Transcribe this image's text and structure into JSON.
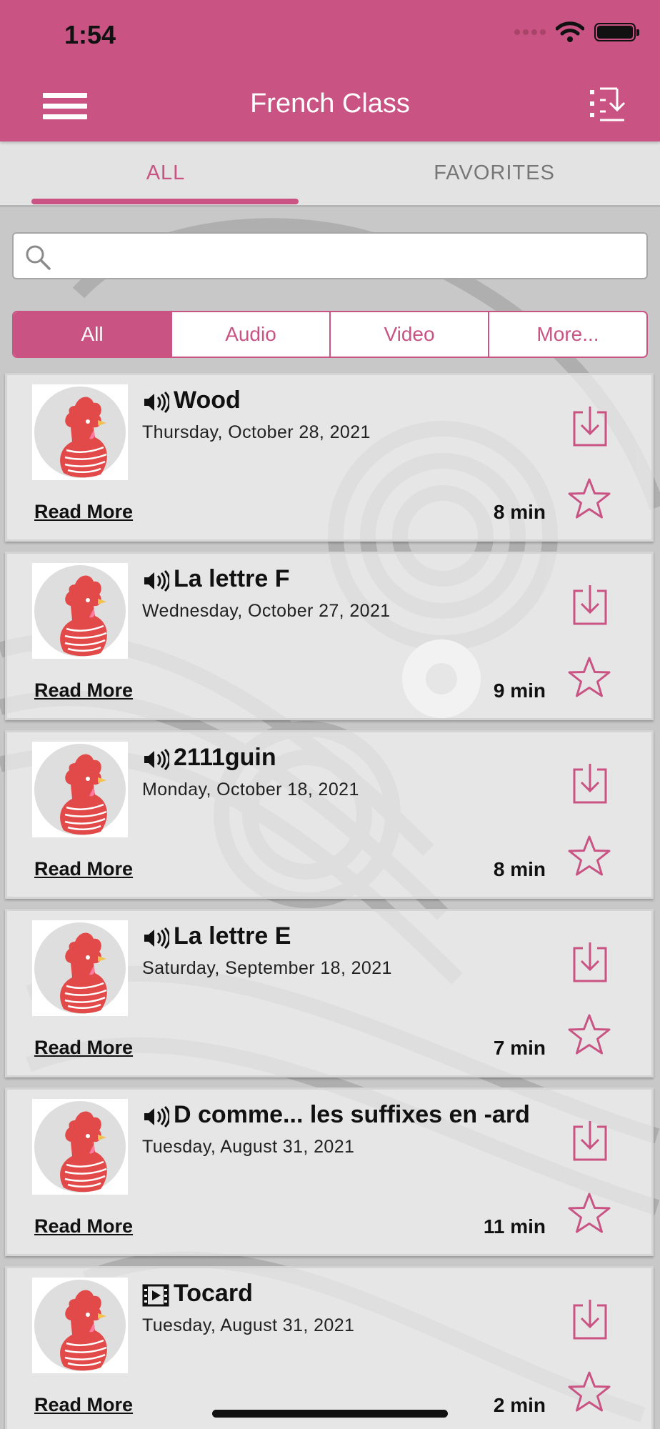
{
  "status_bar": {
    "time": "1:54"
  },
  "header": {
    "title": "French Class"
  },
  "tabs": [
    {
      "label": "ALL",
      "active": true
    },
    {
      "label": "FAVORITES",
      "active": false
    }
  ],
  "search": {
    "placeholder": "",
    "value": ""
  },
  "filters": [
    {
      "label": "All",
      "active": true
    },
    {
      "label": "Audio",
      "active": false
    },
    {
      "label": "Video",
      "active": false
    },
    {
      "label": "More...",
      "active": false
    }
  ],
  "episodes": [
    {
      "type": "audio",
      "icon": "speaker-icon",
      "title": "Wood",
      "date": "Thursday, October 28, 2021",
      "duration": "8 min",
      "read_more": "Read More"
    },
    {
      "type": "audio",
      "icon": "speaker-icon",
      "title": "La lettre F",
      "date": "Wednesday, October 27, 2021",
      "duration": "9 min",
      "read_more": "Read More"
    },
    {
      "type": "audio",
      "icon": "speaker-icon",
      "title": "2111guin",
      "date": "Monday, October 18, 2021",
      "duration": "8 min",
      "read_more": "Read More"
    },
    {
      "type": "audio",
      "icon": "speaker-icon",
      "title": "La lettre E",
      "date": "Saturday, September 18, 2021",
      "duration": "7 min",
      "read_more": "Read More"
    },
    {
      "type": "audio",
      "icon": "speaker-icon",
      "title": "D comme... les suffixes en -ard",
      "date": "Tuesday, August 31, 2021",
      "duration": "11 min",
      "read_more": "Read More"
    },
    {
      "type": "video",
      "icon": "film-icon",
      "title": "Tocard",
      "date": "Tuesday, August 31, 2021",
      "duration": "2 min",
      "read_more": "Read More"
    }
  ],
  "colors": {
    "accent": "#c95383",
    "header_bg": "#c95383",
    "card_bg": "#f1f1f1"
  }
}
